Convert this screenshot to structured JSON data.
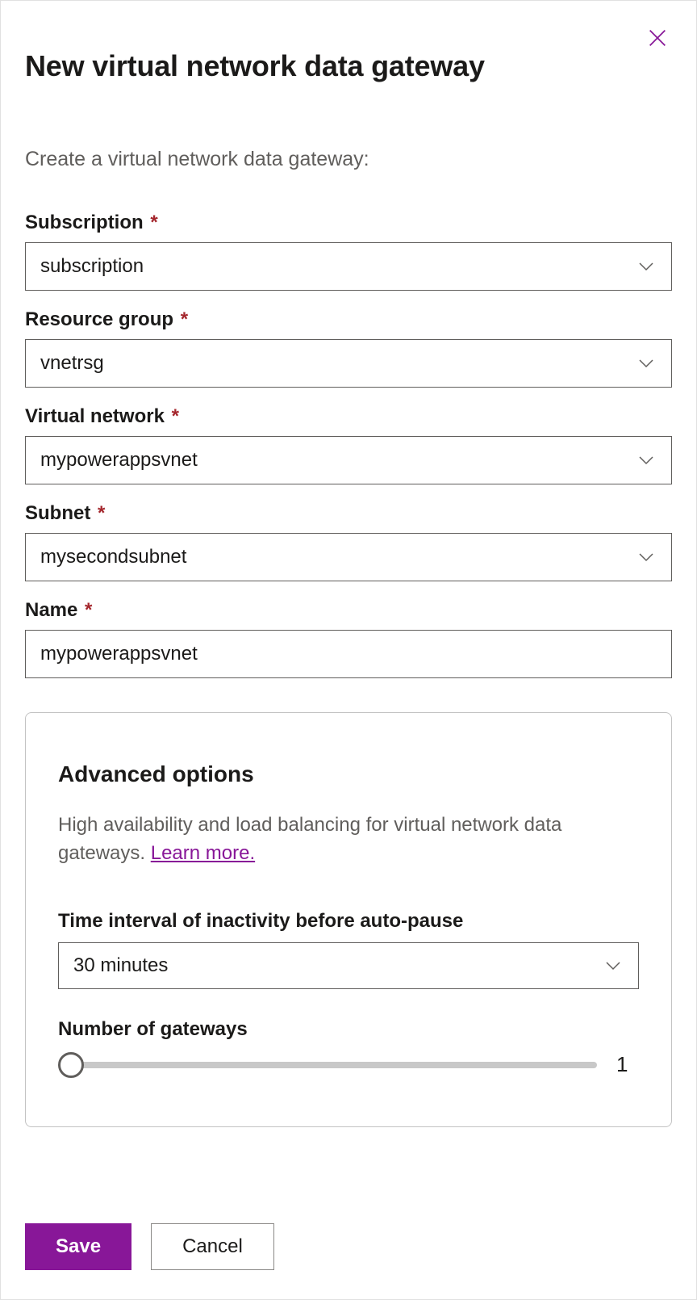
{
  "panel": {
    "title": "New virtual network data gateway",
    "description": "Create a virtual network data gateway:"
  },
  "fields": {
    "subscription": {
      "label": "Subscription",
      "value": "subscription"
    },
    "resourceGroup": {
      "label": "Resource group",
      "value": "vnetrsg"
    },
    "virtualNetwork": {
      "label": "Virtual network",
      "value": "mypowerappsvnet"
    },
    "subnet": {
      "label": "Subnet",
      "value": "mysecondsubnet"
    },
    "name": {
      "label": "Name",
      "value": "mypowerappsvnet"
    }
  },
  "advanced": {
    "title": "Advanced options",
    "description": "High availability and load balancing for virtual network data gateways. ",
    "learnMore": "Learn more.",
    "timeInterval": {
      "label": "Time interval of inactivity before auto-pause",
      "value": "30 minutes"
    },
    "numberOfGateways": {
      "label": "Number of gateways",
      "value": "1"
    }
  },
  "buttons": {
    "save": "Save",
    "cancel": "Cancel"
  },
  "requiredMark": "*"
}
